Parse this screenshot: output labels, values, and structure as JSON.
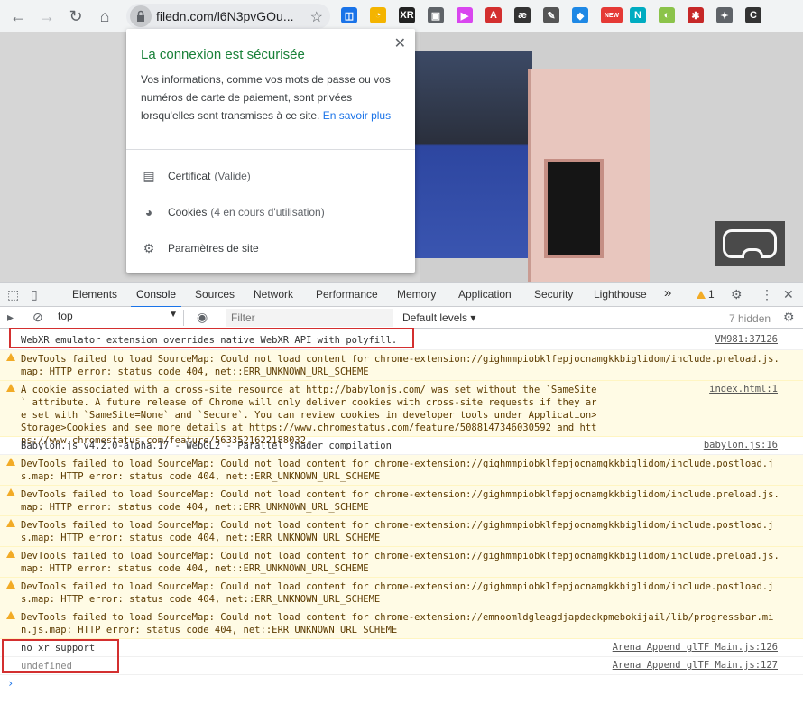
{
  "browser": {
    "url": "filedn.com/l6N3pvGOu...",
    "extensions": [
      {
        "icon": "ext-bookmark-icon",
        "color": "#1a73e8",
        "glyph": "◫"
      },
      {
        "icon": "ext-circle-icon",
        "color": "#f4b400",
        "glyph": "◔"
      },
      {
        "icon": "ext-xr-icon",
        "color": "#222222",
        "glyph": "XR"
      },
      {
        "icon": "ext-briefcase-icon",
        "color": "#5f6368",
        "glyph": "▣"
      },
      {
        "icon": "ext-play-icon",
        "color": "#d946ef",
        "glyph": "▶"
      },
      {
        "icon": "ext-pdf-icon",
        "color": "#d32f2f",
        "glyph": "A"
      },
      {
        "icon": "ext-ae-icon",
        "color": "#333333",
        "glyph": "æ"
      },
      {
        "icon": "ext-pen-icon",
        "color": "#555555",
        "glyph": "✎"
      },
      {
        "icon": "ext-diamond-icon",
        "color": "#1e88e5",
        "glyph": "◆"
      },
      {
        "icon": "ext-new-icon",
        "color": "#e53935",
        "glyph": "NEW"
      },
      {
        "icon": "ext-n-icon",
        "color": "#00acc1",
        "glyph": "N"
      },
      {
        "icon": "ext-leaf-icon",
        "color": "#8bc34a",
        "glyph": "◐"
      },
      {
        "icon": "ext-spider-icon",
        "color": "#c62828",
        "glyph": "✱"
      },
      {
        "icon": "ext-puzzle-icon",
        "color": "#5f6368",
        "glyph": "✦"
      },
      {
        "icon": "ext-ce-icon",
        "color": "#333333",
        "glyph": "C"
      }
    ]
  },
  "popup": {
    "title": "La connexion est sécurisée",
    "description": "Vos informations, comme vos mots de passe ou vos numéros de carte de paiement, sont privées lorsqu'elles sont transmises à ce site.",
    "learn_more": "En savoir plus",
    "items": [
      {
        "label": "Certificat",
        "sub": "(Valide)"
      },
      {
        "label": "Cookies",
        "sub": "(4 en cours d'utilisation)"
      },
      {
        "label": "Paramètres de site",
        "sub": ""
      }
    ]
  },
  "devtools": {
    "tabs": [
      "Elements",
      "Console",
      "Sources",
      "Network",
      "Performance",
      "Memory",
      "Application",
      "Security",
      "Lighthouse"
    ],
    "active_tab": "Console",
    "more": "»",
    "warning_count": "1",
    "context": "top",
    "filter_placeholder": "Filter",
    "levels": "Default levels",
    "hidden": "7 hidden"
  },
  "console": {
    "messages": [
      {
        "type": "info",
        "text": "WebXR emulator extension overrides native WebXR API with polyfill.",
        "source": "VM981:37126"
      },
      {
        "type": "warn",
        "text": "DevTools failed to load SourceMap: Could not load content for chrome-extension://gighmmpiobklfepjocnamgkkbiglidom/include.preload.js.map: HTTP error: status code 404, net::ERR_UNKNOWN_URL_SCHEME",
        "source": ""
      },
      {
        "type": "warn",
        "text": "A cookie associated with a cross-site resource at http://babylonjs.com/ was set without the `SameSite` attribute. A future release of Chrome will only deliver cookies with cross-site requests if they are set with `SameSite=None` and `Secure`. You can review cookies in developer tools under Application>Storage>Cookies and see more details at https://www.chromestatus.com/feature/5088147346030592 and https://www.chromestatus.com/feature/5633521622188032.",
        "source": "index.html:1"
      },
      {
        "type": "info",
        "text": "Babylon.js v4.2.0-alpha.17 - WebGL2 - Parallel shader compilation",
        "source": "babylon.js:16"
      },
      {
        "type": "warn",
        "text": "DevTools failed to load SourceMap: Could not load content for chrome-extension://gighmmpiobklfepjocnamgkkbiglidom/include.postload.js.map: HTTP error: status code 404, net::ERR_UNKNOWN_URL_SCHEME",
        "source": ""
      },
      {
        "type": "warn",
        "text": "DevTools failed to load SourceMap: Could not load content for chrome-extension://gighmmpiobklfepjocnamgkkbiglidom/include.preload.js.map: HTTP error: status code 404, net::ERR_UNKNOWN_URL_SCHEME",
        "source": ""
      },
      {
        "type": "warn",
        "text": "DevTools failed to load SourceMap: Could not load content for chrome-extension://gighmmpiobklfepjocnamgkkbiglidom/include.postload.js.map: HTTP error: status code 404, net::ERR_UNKNOWN_URL_SCHEME",
        "source": ""
      },
      {
        "type": "warn",
        "text": "DevTools failed to load SourceMap: Could not load content for chrome-extension://gighmmpiobklfepjocnamgkkbiglidom/include.preload.js.map: HTTP error: status code 404, net::ERR_UNKNOWN_URL_SCHEME",
        "source": ""
      },
      {
        "type": "warn",
        "text": "DevTools failed to load SourceMap: Could not load content for chrome-extension://gighmmpiobklfepjocnamgkkbiglidom/include.postload.js.map: HTTP error: status code 404, net::ERR_UNKNOWN_URL_SCHEME",
        "source": ""
      },
      {
        "type": "warn",
        "text": "DevTools failed to load SourceMap: Could not load content for chrome-extension://emnoomldgleagdjapdeckpmebokijail/lib/progressbar.min.js.map: HTTP error: status code 404, net::ERR_UNKNOWN_URL_SCHEME",
        "source": ""
      },
      {
        "type": "info",
        "text": "no xr support",
        "source": "Arena Append glTF Main.js:126"
      },
      {
        "type": "result",
        "text": "undefined",
        "source": "Arena Append glTF Main.js:127"
      }
    ]
  }
}
